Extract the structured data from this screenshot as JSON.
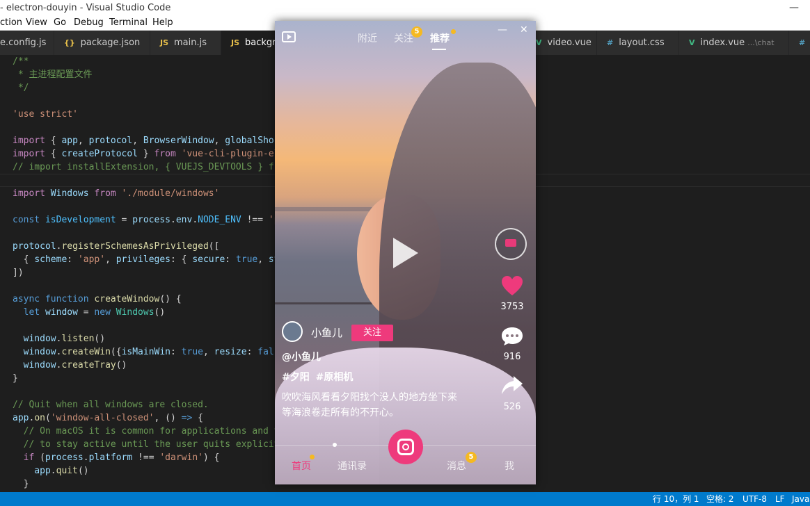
{
  "window": {
    "title": "- electron-douyin - Visual Studio Code",
    "minimize": "—"
  },
  "menu": [
    "ction",
    "View",
    "Go",
    "Debug",
    "Terminal",
    "Help"
  ],
  "tabs": [
    {
      "icon": "JS",
      "label": "e.config.js",
      "type": "js"
    },
    {
      "icon": "{}",
      "label": "package.json",
      "type": "json"
    },
    {
      "icon": "JS",
      "label": "main.js",
      "type": "js"
    },
    {
      "icon": "JS",
      "label": "backgro",
      "type": "js",
      "active": true
    },
    {
      "icon": "V",
      "label": "video.vue",
      "type": "vue"
    },
    {
      "icon": "#",
      "label": "layout.css",
      "type": "css"
    },
    {
      "icon": "V",
      "label": "index.vue",
      "extra": "...\\chat",
      "type": "vue"
    },
    {
      "icon": "#",
      "label": "",
      "type": "css"
    }
  ],
  "code": {
    "l1": "/**",
    "l2": " * 主进程配置文件",
    "l3": " */",
    "l5": "'use strict'",
    "l7a": "import",
    "l7b": " { ",
    "l7c": "app",
    "l7d": ", ",
    "l7e": "protocol",
    "l7f": ", ",
    "l7g": "BrowserWindow",
    "l7h": ", ",
    "l7i": "globalShor",
    "l8a": "import",
    "l8b": " { ",
    "l8c": "createProtocol",
    "l8d": " } ",
    "l8e": "from",
    "l8f": " 'vue-cli-plugin-el",
    "l9": "// import installExtension, { VUEJS_DEVTOOLS } fr",
    "l11a": "import",
    "l11b": " Windows ",
    "l11c": "from",
    "l11d": " './module/windows'",
    "l13a": "const",
    "l13b": " isDevelopment",
    "l13c": " = ",
    "l13d": "process",
    "l13e": ".",
    "l13f": "env",
    "l13g": ".",
    "l13h": "NODE_ENV",
    "l13i": " !== ",
    "l13j": "'p",
    "l15a": "protocol",
    "l15b": ".",
    "l15c": "registerSchemesAsPrivileged",
    "l15d": "([",
    "l16a": "  { ",
    "l16b": "scheme",
    "l16c": ": ",
    "l16d": "'app'",
    "l16e": ", ",
    "l16f": "privileges",
    "l16g": ": { ",
    "l16h": "secure",
    "l16i": ": ",
    "l16j": "true",
    "l16k": ", ",
    "l16l": "st",
    "l17": "])",
    "l19a": "async",
    "l19b": " function",
    "l19c": " createWindow",
    "l19d": "() {",
    "l20a": "  let",
    "l20b": " window",
    "l20c": " = ",
    "l20d": "new",
    "l20e": " Windows",
    "l20f": "()",
    "l22a": "  window",
    "l22b": ".",
    "l22c": "listen",
    "l22d": "()",
    "l23a": "  window",
    "l23b": ".",
    "l23c": "createWin",
    "l23d": "({",
    "l23e": "isMainWin",
    "l23f": ": ",
    "l23g": "true",
    "l23h": ", ",
    "l23i": "resize",
    "l23j": ": ",
    "l23k": "fals",
    "l24a": "  window",
    "l24b": ".",
    "l24c": "createTray",
    "l24d": "()",
    "l25": "}",
    "l27": "// Quit when all windows are closed.",
    "l28a": "app",
    "l28b": ".",
    "l28c": "on",
    "l28d": "(",
    "l28e": "'window-all-closed'",
    "l28f": ", () ",
    "l28g": "=>",
    "l28h": " {",
    "l29": "  // On macOS it is common for applications and t",
    "l30": "  // to stay active until the user quits explicit",
    "l31a": "  if",
    "l31b": " (",
    "l31c": "process",
    "l31d": ".",
    "l31e": "platform",
    "l31f": " !== ",
    "l31g": "'darwin'",
    "l31h": ") {",
    "l32a": "    app",
    "l32b": ".",
    "l32c": "quit",
    "l32d": "()",
    "l33": "  }"
  },
  "status": {
    "position": "行 10，列 1",
    "spaces": "空格: 2",
    "encoding": "UTF-8",
    "eol": "LF",
    "lang": "Javas"
  },
  "app": {
    "top_tabs": [
      "附近",
      "关注",
      "推荐"
    ],
    "follow_badge": "5",
    "win_min": "—",
    "win_close": "✕",
    "likes": "3753",
    "comments": "916",
    "shares": "526",
    "user_name": "小鱼儿",
    "follow_label": "关注",
    "handle": "@小鱼儿",
    "tags": "#夕阳 #原相机",
    "description": "吹吹海风看看夕阳找个没人的地方坐下来 等海浪卷走所有的不开心。",
    "bottom_nav": [
      "首页",
      "通讯录",
      "消息",
      "我"
    ],
    "msg_badge": "5",
    "progress_fraction": 0.23,
    "accent_color": "#ee3a7c"
  }
}
